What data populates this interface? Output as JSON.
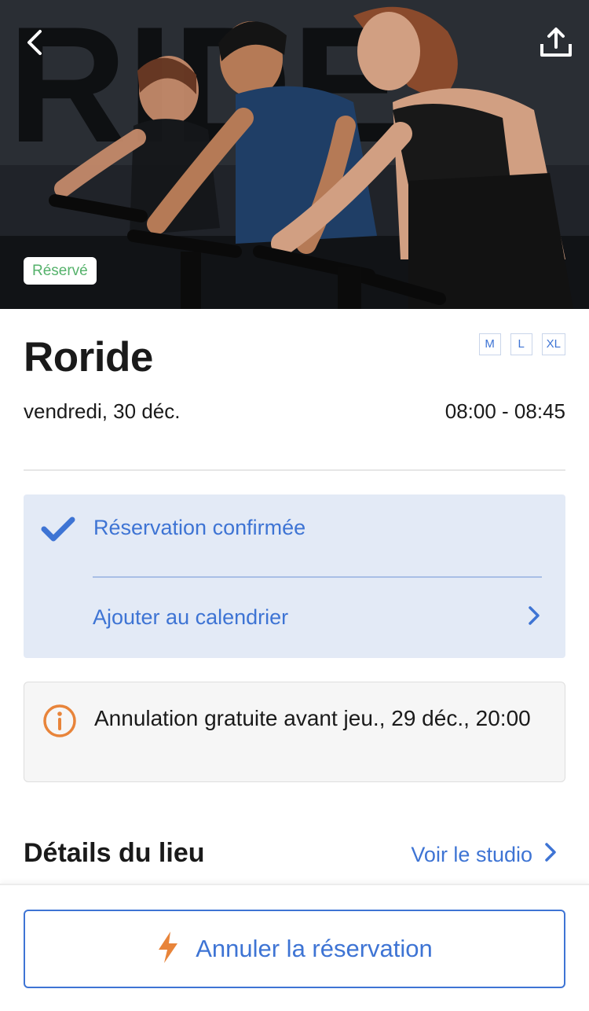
{
  "hero": {
    "badge": "Réservé",
    "back_icon": "chevron-left-icon",
    "share_icon": "share-upload-icon",
    "wall_text": "RIDE"
  },
  "class": {
    "title": "Roride",
    "sizes": [
      "M",
      "L",
      "XL"
    ],
    "date": "vendredi, 30 déc.",
    "time": "08:00 - 08:45"
  },
  "confirmation": {
    "status": "Réservation confirmée",
    "calendar_link": "Ajouter au calendrier",
    "check_icon": "checkmark-icon",
    "chevron_icon": "chevron-right-icon"
  },
  "cancellation_info": {
    "text": "Annulation gratuite avant jeu., 29 déc., 20:00",
    "icon": "info-circle-icon"
  },
  "venue": {
    "title": "Détails du lieu",
    "link": "Voir le studio"
  },
  "bottom": {
    "cancel_label": "Annuler la réservation",
    "icon": "lightning-bolt-icon"
  },
  "colors": {
    "accent": "#3e74d4",
    "confirm_bg": "#e3eaf6",
    "badge_green": "#55b26b",
    "warning_orange": "#e8843a"
  }
}
